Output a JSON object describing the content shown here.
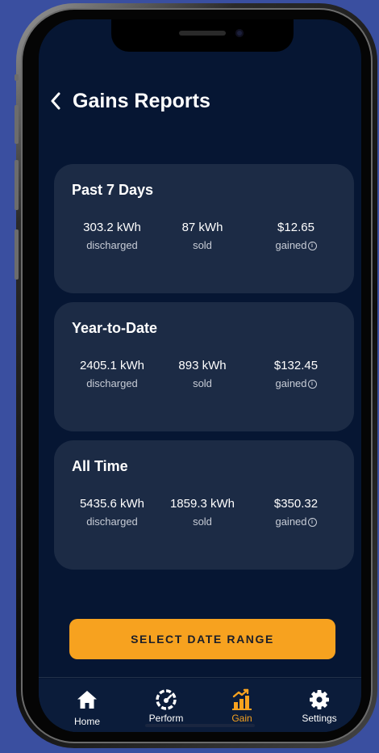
{
  "header": {
    "title": "Gains Reports"
  },
  "cards": [
    {
      "title": "Past 7 Days",
      "stats": [
        {
          "value": "303.2 kWh",
          "label": "discharged"
        },
        {
          "value": "87 kWh",
          "label": "sold"
        },
        {
          "value": "$12.65",
          "label": "gained"
        }
      ]
    },
    {
      "title": "Year-to-Date",
      "stats": [
        {
          "value": "2405.1 kWh",
          "label": "discharged"
        },
        {
          "value": "893 kWh",
          "label": "sold"
        },
        {
          "value": "$132.45",
          "label": "gained"
        }
      ]
    },
    {
      "title": "All Time",
      "stats": [
        {
          "value": "5435.6 kWh",
          "label": "discharged"
        },
        {
          "value": "1859.3 kWh",
          "label": "sold"
        },
        {
          "value": "$350.32",
          "label": "gained"
        }
      ]
    }
  ],
  "cta": {
    "label": "SELECT DATE RANGE"
  },
  "tabs": [
    {
      "label": "Home",
      "icon": "home-icon"
    },
    {
      "label": "Perform",
      "icon": "speedometer-icon"
    },
    {
      "label": "Gain",
      "icon": "bar-chart-icon"
    },
    {
      "label": "Settings",
      "icon": "gear-icon"
    }
  ],
  "active_tab": "Gain",
  "colors": {
    "background": "#061633",
    "card": "#1c2b45",
    "accent": "#f7a21f",
    "text": "#ffffff",
    "muted": "#c7ccd6"
  }
}
